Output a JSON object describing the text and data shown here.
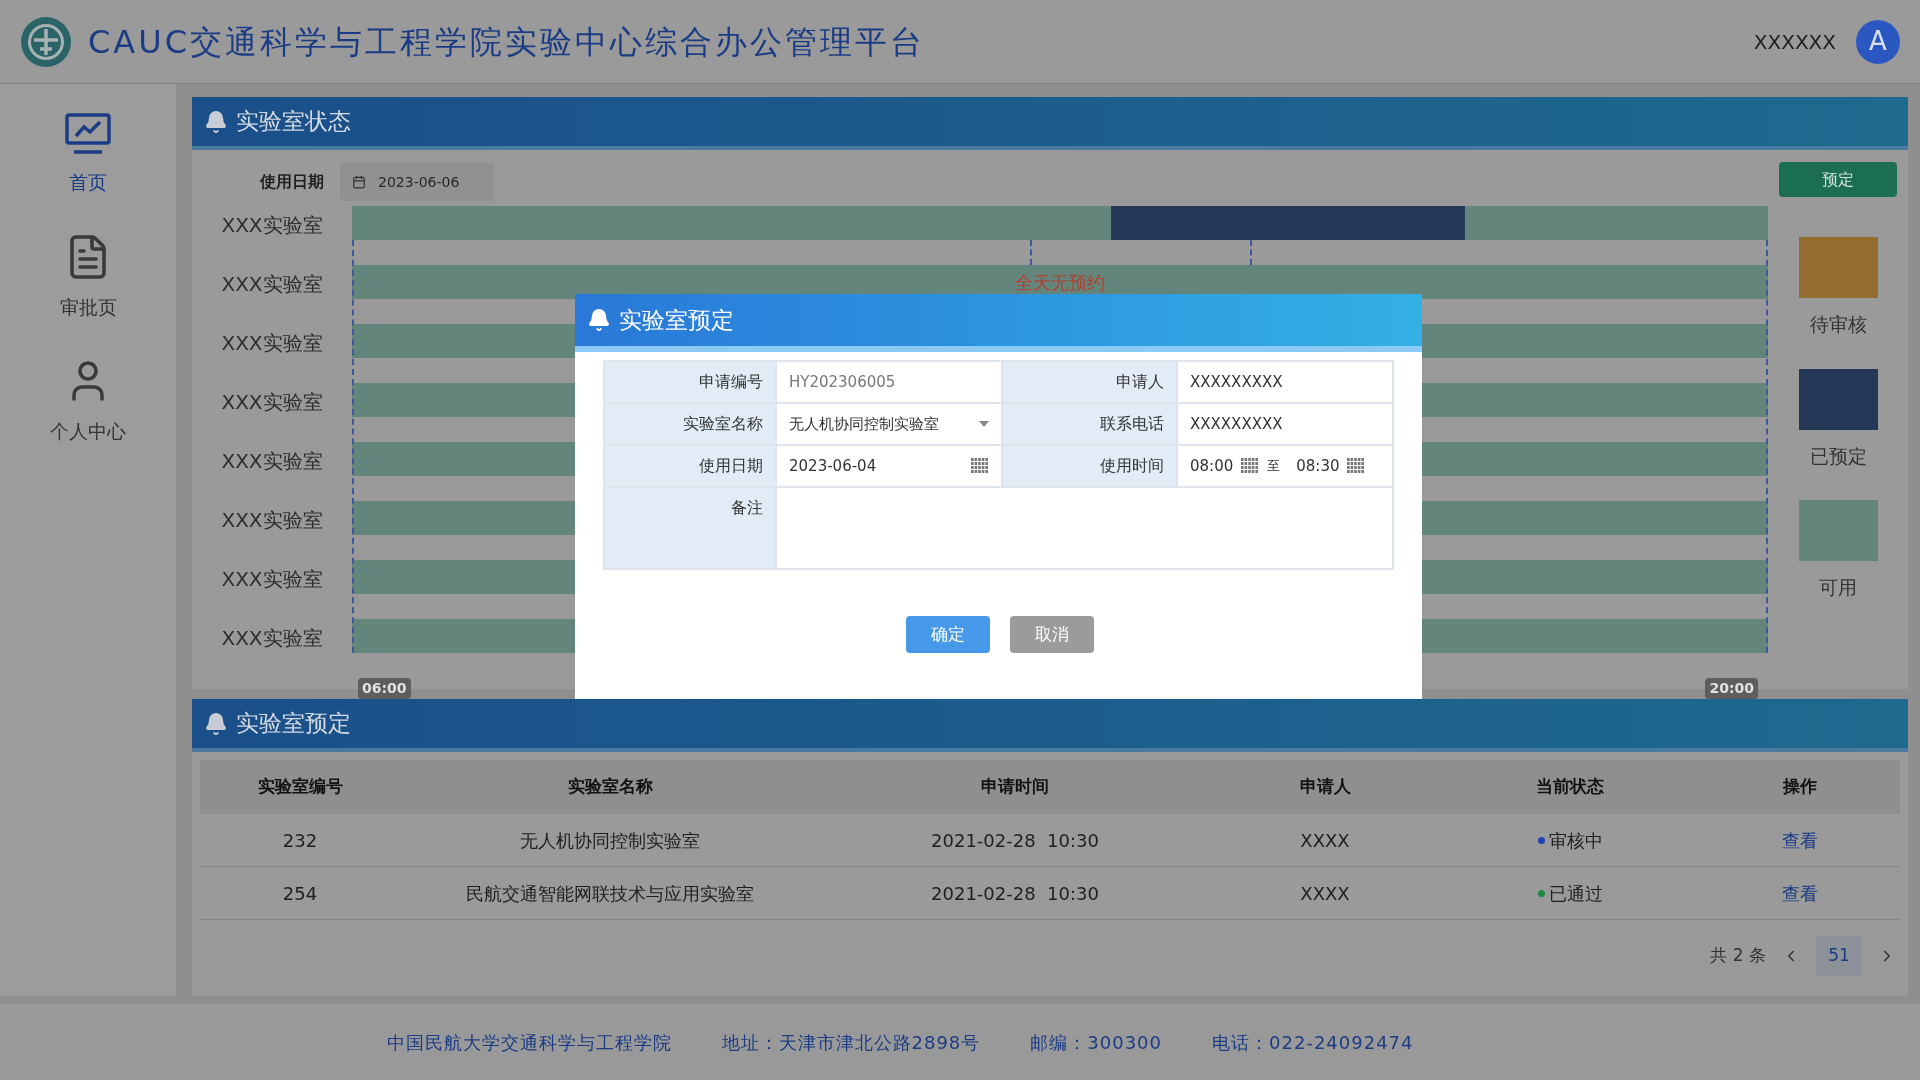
{
  "header": {
    "title": "CAUC交通科学与工程学院实验中心综合办公管理平台",
    "user_name": "XXXXXX",
    "avatar": "A"
  },
  "sidebar": {
    "items": [
      {
        "label": "首页",
        "kind": "chart",
        "selected": true
      },
      {
        "label": "审批页",
        "kind": "document",
        "selected": false
      },
      {
        "label": "个人中心",
        "kind": "user",
        "selected": false
      }
    ]
  },
  "status_panel": {
    "title": "实验室状态",
    "date_label": "使用日期",
    "date_value": "2023-06-06",
    "book_button": "预定",
    "rows": [
      {
        "label": "XXX实验室",
        "half_hour_slots": [
          {
            "booked": false
          },
          {
            "booked": false
          },
          {
            "booked": false
          },
          {
            "booked": false
          },
          {
            "booked": false
          },
          {
            "booked": false
          },
          {
            "booked": false
          },
          {
            "booked": false
          },
          {
            "booked": false
          },
          {
            "booked": false
          },
          {
            "booked": false
          },
          {
            "booked": false
          },
          {
            "booked": false
          },
          {
            "booked": false
          },
          {
            "booked": false
          },
          {
            "booked": true
          },
          {
            "booked": true
          },
          {
            "booked": true
          },
          {
            "booked": true
          },
          {
            "booked": true
          },
          {
            "booked": true
          },
          {
            "booked": true
          },
          {
            "booked": false
          },
          {
            "booked": false
          },
          {
            "booked": false
          },
          {
            "booked": false
          },
          {
            "booked": false
          },
          {
            "booked": false
          }
        ]
      },
      {
        "label": "XXX实验室",
        "note": "全天无预约"
      },
      {
        "label": "XXX实验室"
      },
      {
        "label": "XXX实验室"
      },
      {
        "label": "XXX实验室"
      },
      {
        "label": "XXX实验室"
      },
      {
        "label": "XXX实验室"
      },
      {
        "label": "XXX实验室"
      }
    ],
    "time_start": "06:00",
    "time_end": "20:00",
    "legend": [
      {
        "label": "待审核",
        "color": "#936d30"
      },
      {
        "label": "已预定",
        "color": "#263858"
      },
      {
        "label": "可用",
        "color": "#64857c"
      }
    ]
  },
  "booking_panel": {
    "title": "实验室预定",
    "columns": [
      "实验室编号",
      "实验室名称",
      "申请时间",
      "申请人",
      "当前状态",
      "操作"
    ],
    "rows": [
      {
        "id": "232",
        "name": "无人机协同控制实验室",
        "time": "2021-02-28  10:30",
        "applicant": "XXXX",
        "status": "审核中",
        "color": "#1f43b0",
        "action": "查看"
      },
      {
        "id": "254",
        "name": "民航交通智能网联技术与应用实验室",
        "time": "2021-02-28  10:30",
        "applicant": "XXXX",
        "status": "已通过",
        "color": "#1e8a3e",
        "action": "查看"
      }
    ],
    "pagination": {
      "total": "共 2 条",
      "pages": [
        {
          "label": "51",
          "selected": true
        }
      ]
    }
  },
  "dialog": {
    "title": "实验室预定",
    "fields": [
      {
        "label": "申请编号",
        "kind": "text",
        "placeholder": "HY202306005"
      },
      {
        "label": "申请人",
        "kind": "text",
        "value": "XXXXXXXXX"
      },
      {
        "label": "实验室名称",
        "kind": "select",
        "value": "无人机协同控制实验室"
      },
      {
        "label": "联系电话",
        "kind": "text",
        "value": "XXXXXXXXX"
      },
      {
        "label": "使用日期",
        "kind": "date",
        "value": "2023-06-04"
      },
      {
        "label": "使用时间",
        "kind": "time_range",
        "from": "08:00",
        "separator": "至",
        "to": "08:30"
      },
      {
        "label": "备注",
        "kind": "textarea"
      }
    ],
    "buttons": [
      {
        "label": "确定",
        "kind": "primary"
      },
      {
        "label": "取消",
        "kind": "secondary"
      }
    ]
  },
  "footer": [
    "中国民航大学交通科学与工程学院",
    "地址：天津市津北公路2898号",
    "邮编：300300",
    "电话：022-24092474"
  ]
}
